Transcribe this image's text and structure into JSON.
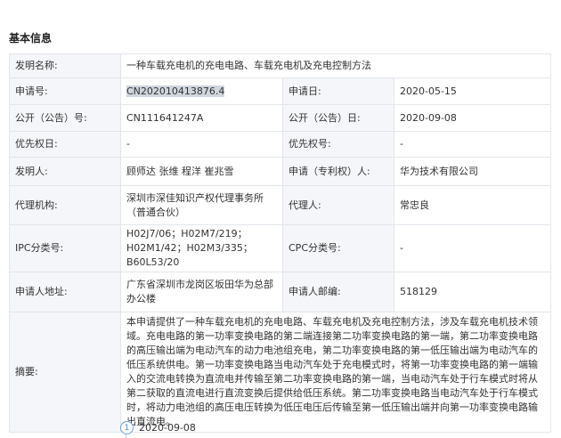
{
  "section_title": "基本信息",
  "rows": [
    {
      "l1": "发明名称:",
      "v1": "一种车载充电机的充电电路、车载充电机及充电控制方法"
    },
    {
      "l1": "申请号:",
      "v1": "CN202010413876.4",
      "l2": "申请日:",
      "v2": "2020-05-15"
    },
    {
      "l1": "公开（公告）号:",
      "v1": "CN111641247A",
      "l2": "公开（公告）日:",
      "v2": "2020-09-08"
    },
    {
      "l1": "优先权日:",
      "v1": "-",
      "l2": "优先权号:",
      "v2": "-"
    },
    {
      "l1": "发明人:",
      "v1": "顾师达 张维 程洋 崔兆雪",
      "l2": "申请（专利权）人:",
      "v2": "华为技术有限公司"
    },
    {
      "l1": "代理机构:",
      "v1": "深圳市深佳知识产权代理事务所（普通合伙）",
      "l2": "代理人:",
      "v2": "常忠良"
    },
    {
      "l1": "IPC分类号:",
      "v1": "H02J7/06；H02M7/219；H02M1/42；H02M3/335；B60L53/20",
      "l2": "CPC分类号:",
      "v2": "-"
    },
    {
      "l1": "申请人地址:",
      "v1": "广东省深圳市龙岗区坂田华为总部办公楼",
      "l2": "申请人邮编:",
      "v2": "518129"
    },
    {
      "l1": "摘要:",
      "v1": "本申请提供了一种车载充电机的充电电路、车载充电机及充电控制方法，涉及车载充电机技术领域。充电电路的第一功率变换电路的第二端连接第二功率变换电路的第一端，第二功率变换电路的高压输出端为电动汽车的动力电池组充电，第二功率变换电路的第一低压输出端为电动汽车的低压系统供电。第一功率变换电路当电动汽车处于充电模式时，将第一功率变换电路的第一端输入的交流电转换为直流电并传输至第二功率变换电路的第一端，当电动汽车处于行车模式时将从第二获取的直流电进行直流变换后提供给低压系统。第二功率变换电路当电动汽车处于行车模式时，将动力电池组的高压电压转换为低压电压后传输至第一低压输出端并向第一功率变换电路输出直流电。"
    }
  ],
  "timeline": {
    "index": "1",
    "date": "2020-09-08"
  }
}
